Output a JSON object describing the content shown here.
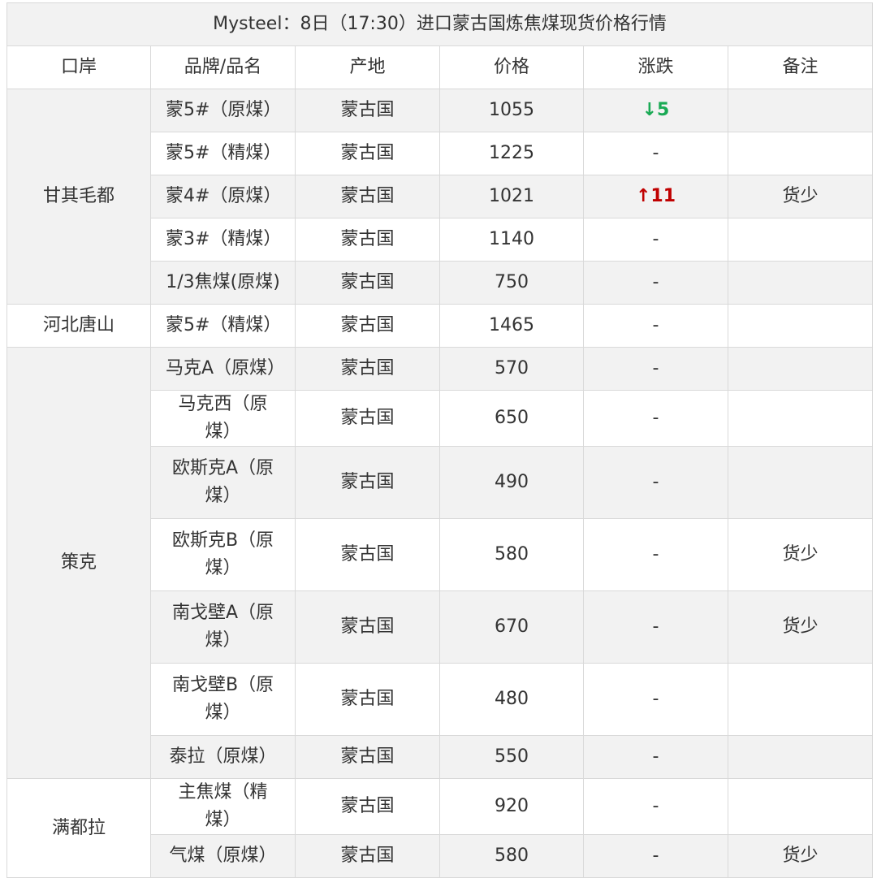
{
  "title": "Mysteel：8日（17:30）进口蒙古国炼焦煤现货价格行情",
  "headers": [
    "口岸",
    "品牌/品名",
    "产地",
    "价格",
    "涨跌",
    "备注"
  ],
  "ports": [
    "甘其毛都",
    "河北唐山",
    "策克",
    "满都拉"
  ],
  "rows": [
    {
      "brand": "蒙5#（原煤）",
      "origin": "蒙古国",
      "price": "1055",
      "change": "↓5",
      "note": ""
    },
    {
      "brand": "蒙5#（精煤）",
      "origin": "蒙古国",
      "price": "1225",
      "change": "-",
      "note": ""
    },
    {
      "brand": "蒙4#（原煤）",
      "origin": "蒙古国",
      "price": "1021",
      "change": "↑11",
      "note": "货少"
    },
    {
      "brand": "蒙3#（精煤）",
      "origin": "蒙古国",
      "price": "1140",
      "change": "-",
      "note": ""
    },
    {
      "brand": "1/3焦煤(原煤)",
      "origin": "蒙古国",
      "price": "750",
      "change": "-",
      "note": ""
    },
    {
      "brand": "蒙5#（精煤）",
      "origin": "蒙古国",
      "price": "1465",
      "change": "-",
      "note": ""
    },
    {
      "brand": "马克A（原煤）",
      "origin": "蒙古国",
      "price": "570",
      "change": "-",
      "note": ""
    },
    {
      "brand": "马克西（原煤）",
      "origin": "蒙古国",
      "price": "650",
      "change": "-",
      "note": ""
    },
    {
      "brand": "欧斯克A（原煤）",
      "origin": "蒙古国",
      "price": "490",
      "change": "-",
      "note": ""
    },
    {
      "brand": "欧斯克B（原煤）",
      "origin": "蒙古国",
      "price": "580",
      "change": "-",
      "note": "货少"
    },
    {
      "brand": "南戈壁A（原煤）",
      "origin": "蒙古国",
      "price": "670",
      "change": "-",
      "note": "货少"
    },
    {
      "brand": "南戈壁B（原煤）",
      "origin": "蒙古国",
      "price": "480",
      "change": "-",
      "note": ""
    },
    {
      "brand": "泰拉（原煤）",
      "origin": "蒙古国",
      "price": "550",
      "change": "-",
      "note": ""
    },
    {
      "brand": "主焦煤（精煤）",
      "origin": "蒙古国",
      "price": "920",
      "change": "-",
      "note": ""
    },
    {
      "brand": "气煤（原煤）",
      "origin": "蒙古国",
      "price": "580",
      "change": "-",
      "note": "货少"
    }
  ]
}
